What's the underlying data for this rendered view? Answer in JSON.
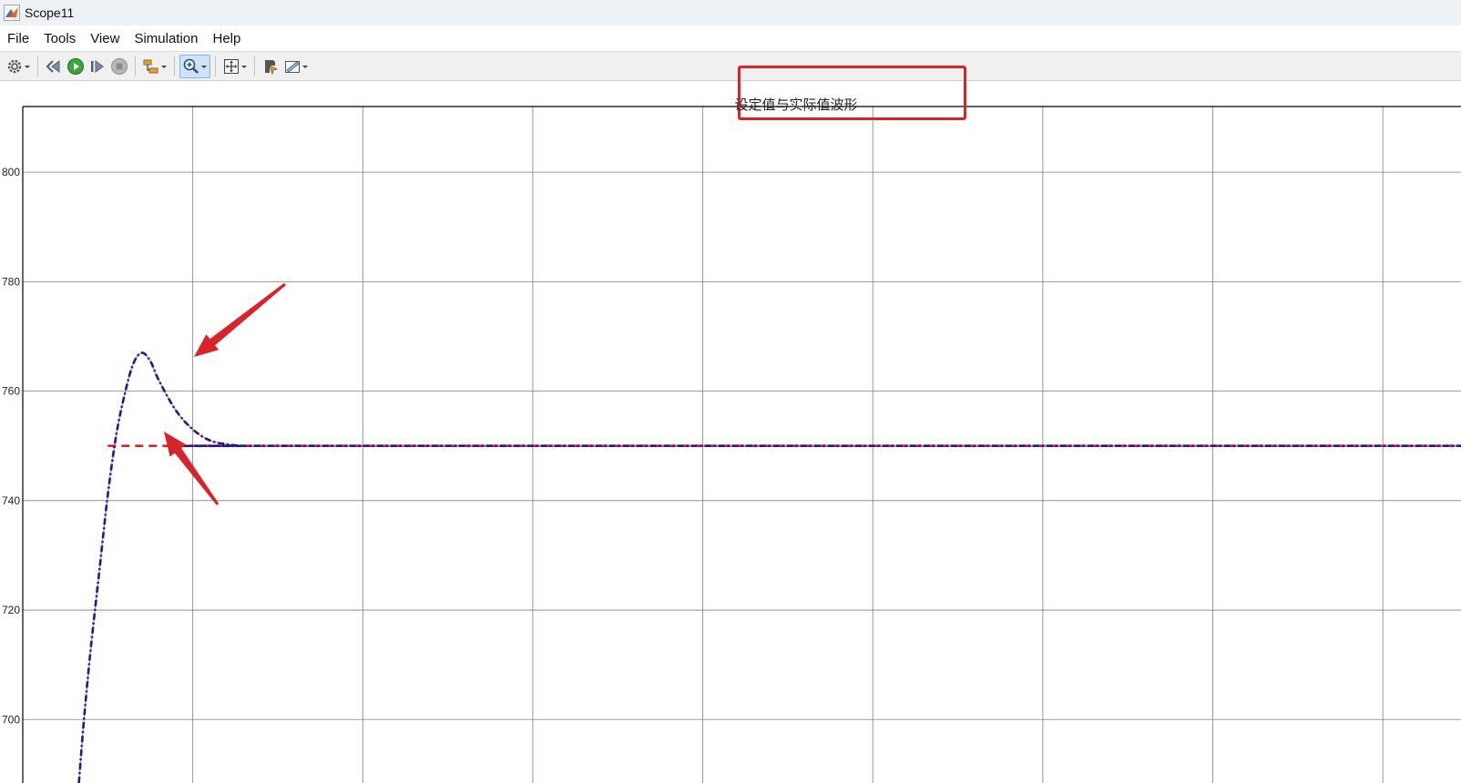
{
  "window": {
    "title": "Scope11"
  },
  "menu": {
    "items": [
      "File",
      "Tools",
      "View",
      "Simulation",
      "Help"
    ]
  },
  "toolbar": {
    "buttons": [
      "configuration-gear-icon",
      "step-back-icon",
      "run-icon",
      "step-forward-icon",
      "stop-icon",
      "signal-selector-icon",
      "zoom-in-icon",
      "autoscale-icon",
      "highlight-block-icon",
      "style-icon"
    ],
    "active_button": "zoom-in-icon"
  },
  "plot_title": "设定值与实际值波形",
  "colors": {
    "actual_value": "#1a1a8c",
    "set_value": "#d9232a",
    "annotation_red": "#d9232a",
    "grid": "#7f7f7f",
    "toolbar_active": "#cfe3f7"
  },
  "chart_data": {
    "type": "line",
    "title": "设定值与实际值波形",
    "xlabel": "",
    "ylabel": "",
    "ylim": [
      688.4,
      812
    ],
    "xlim": [
      0,
      8.46
    ],
    "y_ticks": [
      700,
      720,
      740,
      760,
      780,
      800
    ],
    "x_tick_labels_shown": false,
    "grid": true,
    "series": [
      {
        "style": "dash-dot",
        "x": [
          0.33,
          0.36,
          0.4,
          0.45,
          0.5,
          0.55,
          0.6,
          0.65,
          0.7,
          0.75,
          0.8,
          0.9,
          1.0,
          1.1,
          1.2,
          1.3,
          1.5,
          8.46
        ],
        "y": [
          688.4,
          700,
          713,
          727,
          741,
          752,
          759.5,
          765,
          767,
          765.5,
          762,
          756.5,
          753,
          751,
          750.3,
          750,
          750,
          750
        ]
      },
      {
        "style": "dashed",
        "x": [
          0.5,
          8.46
        ],
        "y": [
          750,
          750
        ]
      }
    ],
    "annotations": [
      {
        "type": "arrow",
        "color": "#d9232a",
        "points_to": "overshoot peak"
      },
      {
        "type": "arrow",
        "color": "#d9232a",
        "points_to": "set value line"
      },
      {
        "type": "box",
        "color": "#d9232a",
        "encloses": "plot title"
      }
    ]
  }
}
